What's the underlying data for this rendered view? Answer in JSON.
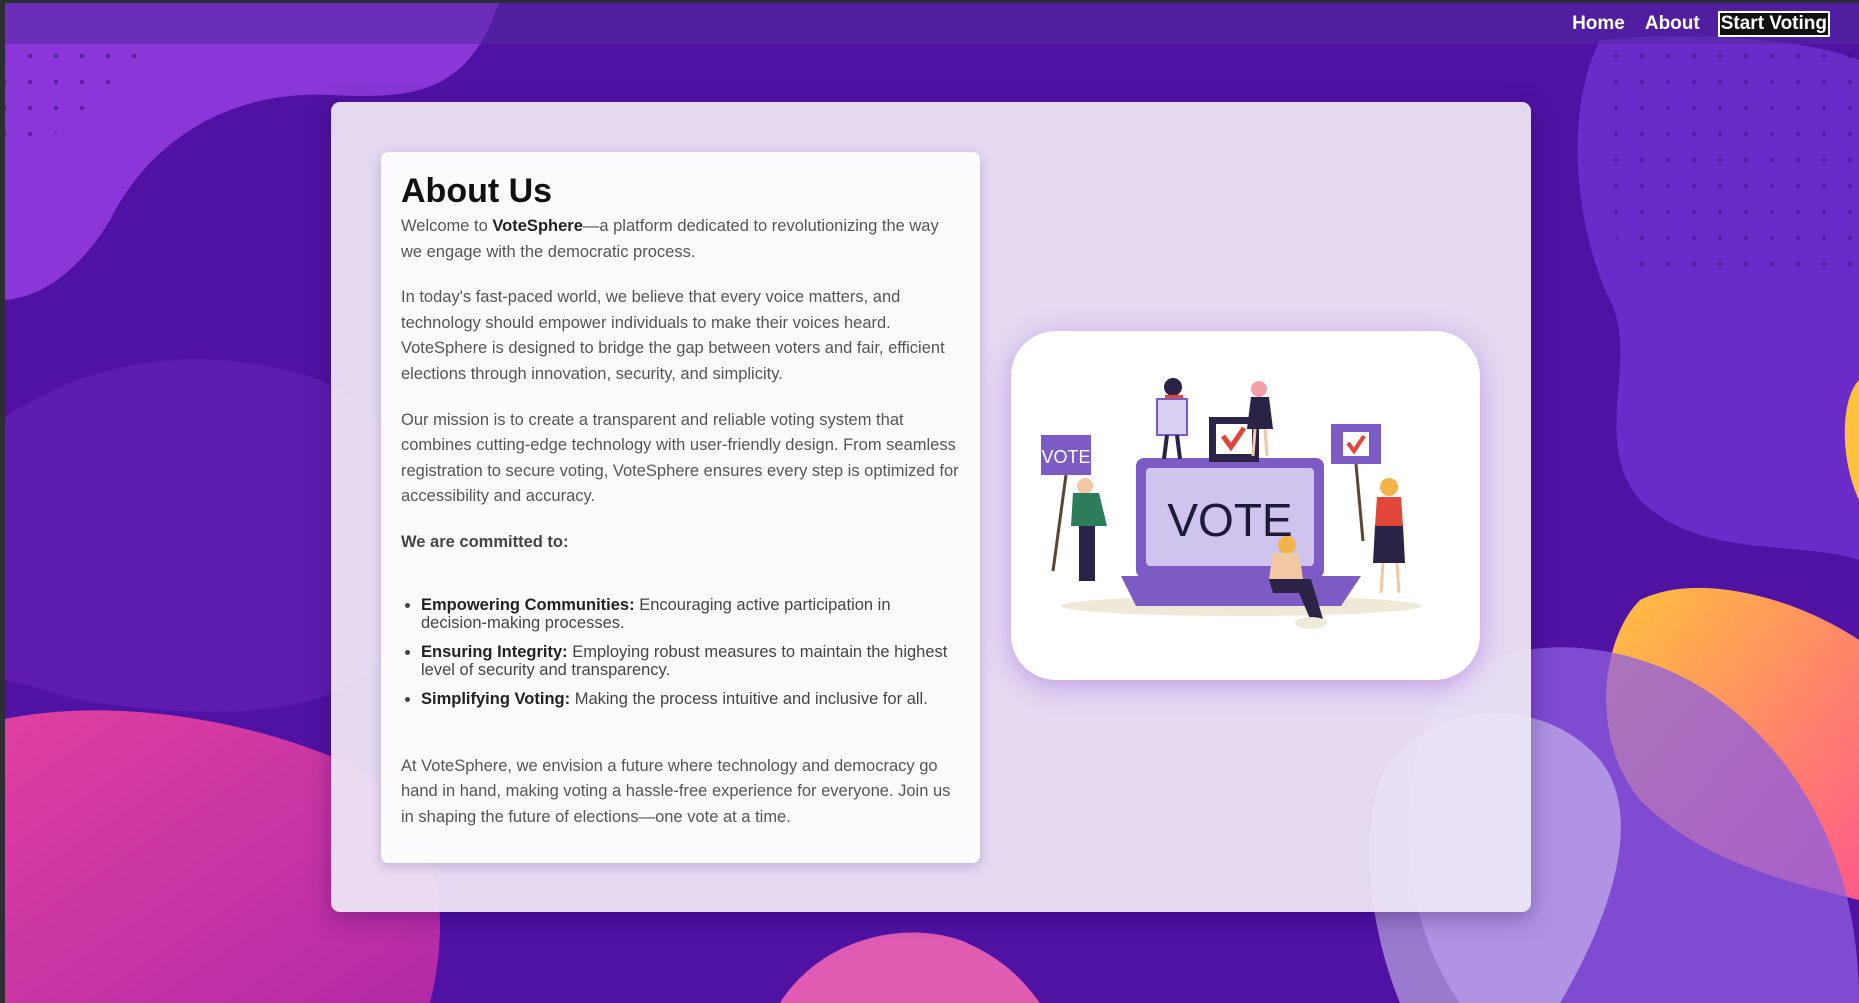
{
  "nav": {
    "links": [
      {
        "label": "Home"
      },
      {
        "label": "About"
      },
      {
        "label": "Start Voting"
      }
    ]
  },
  "about": {
    "title": "About Us",
    "intro_prefix": "Welcome to ",
    "brand": "VoteSphere",
    "intro_suffix": "—a platform dedicated to revolutionizing the way we engage with the democratic process.",
    "paragraph_2": "In today's fast-paced world, we believe that every voice matters, and technology should empower individuals to make their voices heard. VoteSphere is designed to bridge the gap between voters and fair, efficient elections through innovation, security, and simplicity.",
    "paragraph_3": "Our mission is to create a transparent and reliable voting system that combines cutting-edge technology with user-friendly design. From seamless registration to secure voting, VoteSphere ensures every step is optimized for accessibility and accuracy.",
    "committed_heading": "We are committed to:",
    "commitments": [
      {
        "title": "Empowering Communities:",
        "text": " Encouraging active participation in decision-making processes."
      },
      {
        "title": "Ensuring Integrity:",
        "text": " Employing robust measures to maintain the highest level of security and transparency."
      },
      {
        "title": "Simplifying Voting:",
        "text": " Making the process intuitive and inclusive for all."
      }
    ],
    "closing": "At VoteSphere, we envision a future where technology and democracy go hand in hand, making voting a hassle-free experience for everyone. Join us in shaping the future of elections—one vote at a time."
  },
  "illustration": {
    "laptop_text": "VOTE",
    "sign_left_text": "VOTE"
  },
  "colors": {
    "background": "#4a0f9c",
    "accent_purple": "#7c5cc4",
    "check_red": "#e0463a"
  }
}
